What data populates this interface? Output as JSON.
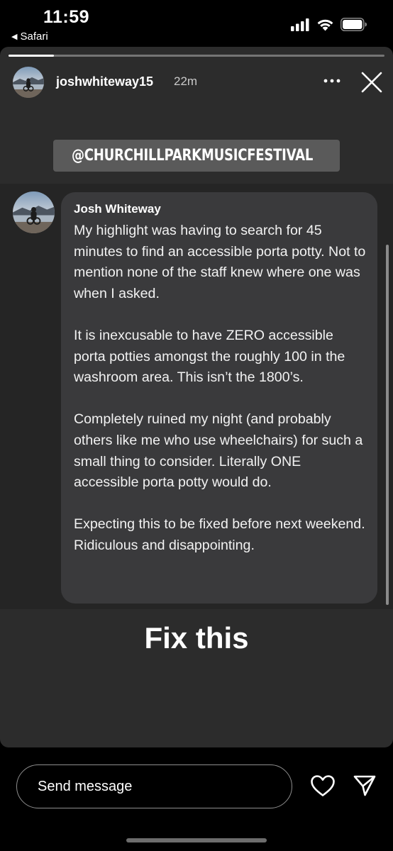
{
  "status_bar": {
    "time": "11:59",
    "back_app": "Safari",
    "icons": [
      "signal-icon",
      "wifi-icon",
      "battery-icon"
    ]
  },
  "story": {
    "progress": 0.12,
    "username": "joshwhiteway15",
    "time_ago": "22m",
    "mention": "@CHURCHILLPARKMUSICFESTIVAL",
    "comment": {
      "author": "Josh Whiteway",
      "paragraphs": [
        "My highlight was having to search for 45 minutes to find an accessible porta potty. Not to mention none of the staff knew where one was when I asked.",
        "It is inexcusable to have ZERO accessible porta potties amongst the roughly 100 in the washroom area. This isn’t the 1800’s.",
        "Completely ruined my night (and probably others like me who use wheelchairs) for such a small thing to consider. Literally ONE accessible porta potty would do.",
        "Expecting this to be fixed before next weekend. Ridiculous and disappointing."
      ]
    },
    "caption": "Fix this"
  },
  "bottom_bar": {
    "message_placeholder": "Send message"
  },
  "colors": {
    "story_bg": "#2c2c2c",
    "bubble_bg": "#3a3a3c",
    "mention_bg": "#5a5a5a"
  }
}
